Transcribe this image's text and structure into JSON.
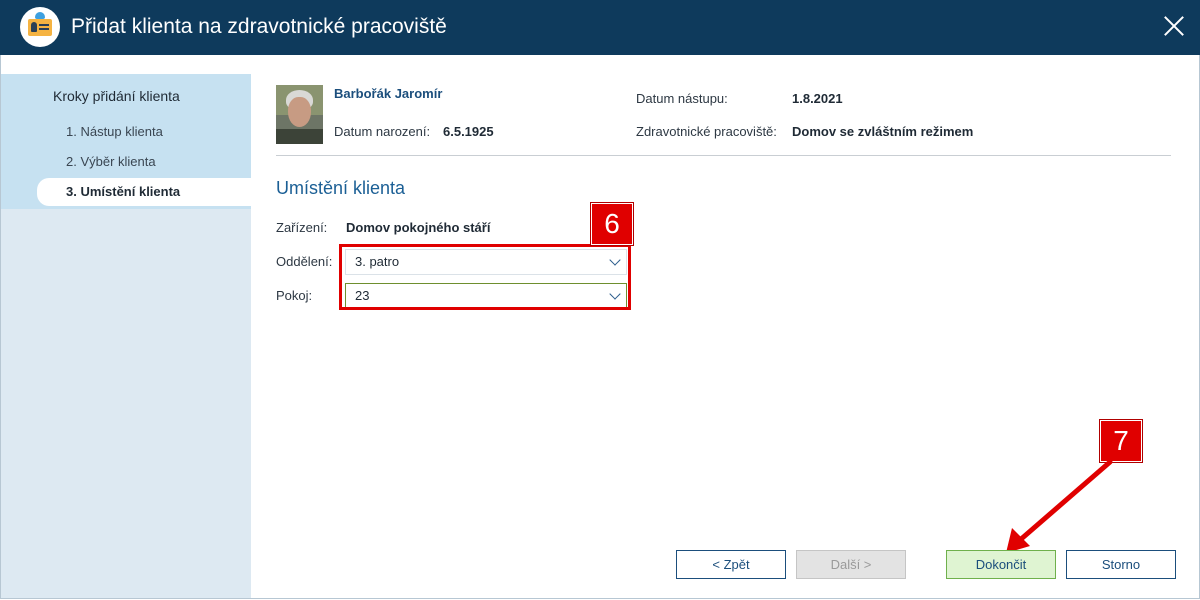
{
  "window": {
    "title": "Přidat klienta na zdravotnické pracoviště",
    "icon": "client-card-icon"
  },
  "sidebar": {
    "heading": "Kroky přidání klienta",
    "steps": [
      {
        "label": "1. Nástup klienta",
        "active": false
      },
      {
        "label": "2. Výběr klienta",
        "active": false
      },
      {
        "label": "3. Umístění klienta",
        "active": true
      }
    ]
  },
  "client": {
    "name": "Barbořák Jaromír",
    "birth_label": "Datum narození:",
    "birth_value": "6.5.1925",
    "start_label": "Datum nástupu:",
    "start_value": "1.8.2021",
    "workplace_label": "Zdravotnické pracoviště:",
    "workplace_value": "Domov se zvláštním režimem"
  },
  "placement": {
    "section_title": "Umístění klienta",
    "facility_label": "Zařízení:",
    "facility_value": "Domov pokojného stáří",
    "department_label": "Oddělení:",
    "department_value": "3. patro",
    "room_label": "Pokoj:",
    "room_value": "23"
  },
  "callouts": {
    "first": "6",
    "second": "7"
  },
  "buttons": {
    "back": "< Zpět",
    "next": "Další >",
    "finish": "Dokončit",
    "cancel": "Storno"
  },
  "colors": {
    "titlebar": "#0e3a5c",
    "accent": "#1b5f95",
    "callout": "#e00000",
    "primary_button": "#dff4d2"
  }
}
